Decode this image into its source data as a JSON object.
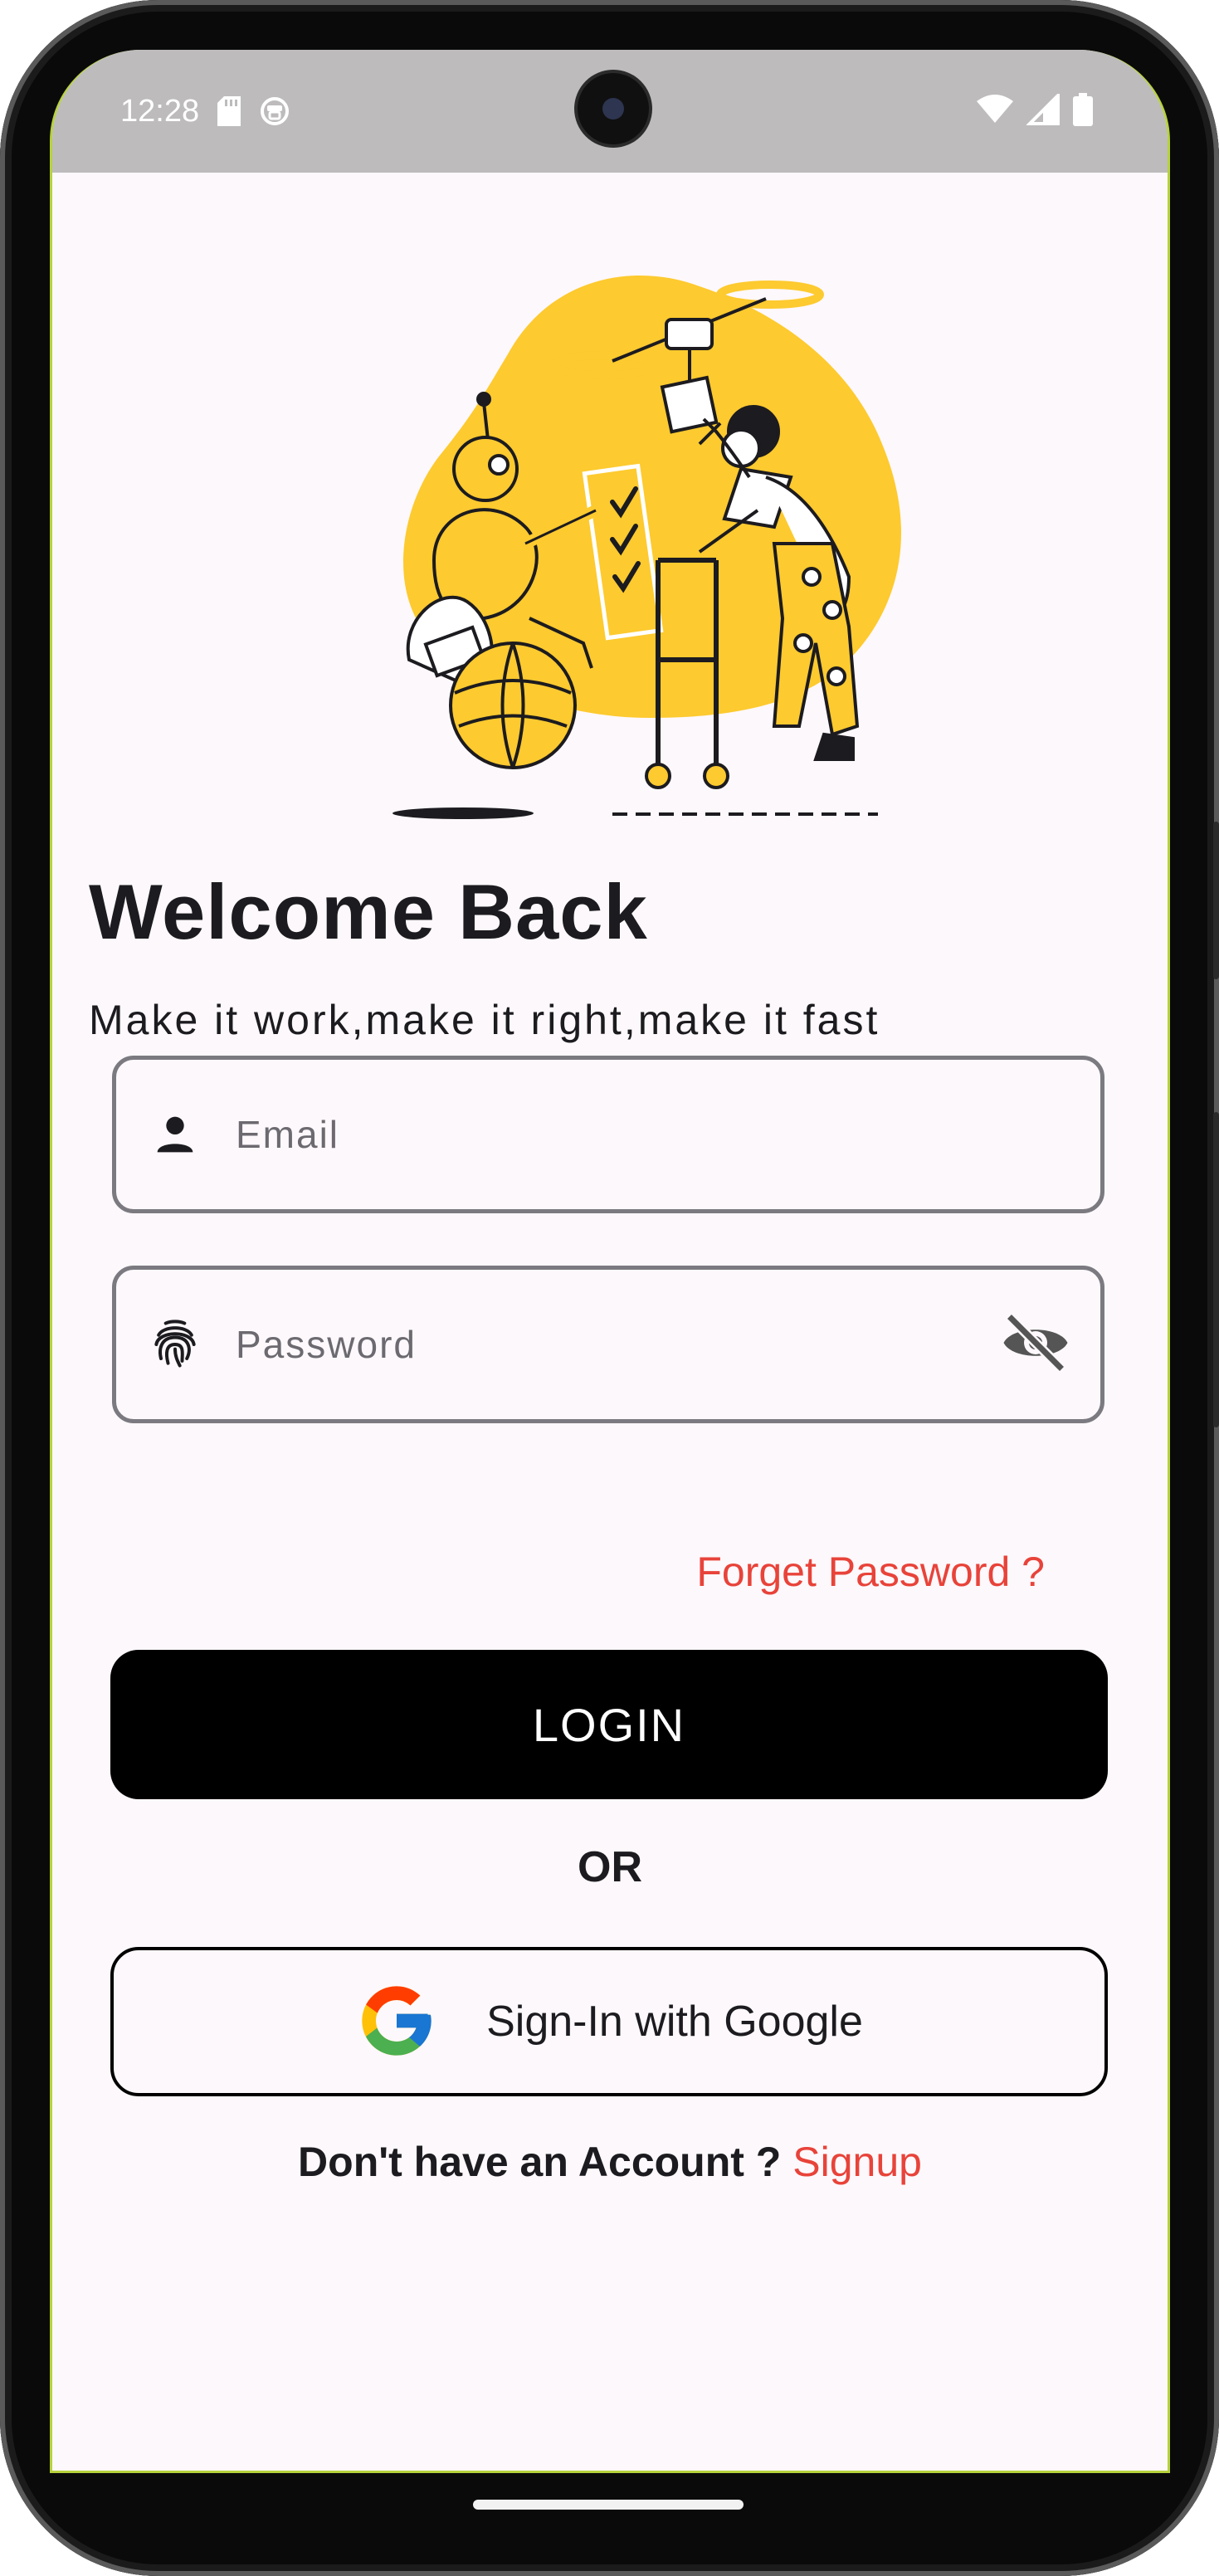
{
  "status_bar": {
    "time": "12:28",
    "left_icons": [
      "sd-card-icon",
      "app-notification-icon"
    ],
    "right_icons": [
      "wifi-icon",
      "cellular-signal-icon",
      "battery-icon"
    ]
  },
  "header": {
    "title": "Welcome Back",
    "subtitle": "Make it work,make it right,make it fast"
  },
  "form": {
    "email": {
      "placeholder": "Email",
      "value": "",
      "icon": "person-icon"
    },
    "password": {
      "placeholder": "Password",
      "value": "",
      "icon": "fingerprint-icon",
      "toggle_icon": "visibility-off-icon"
    },
    "forget_label": "Forget Password ?",
    "login_label": "LOGIN"
  },
  "divider": {
    "label": "OR"
  },
  "google": {
    "label": "Sign-In with Google",
    "icon": "google-icon"
  },
  "footer": {
    "prompt": "Don't have an Account ? ",
    "link": "Signup"
  },
  "colors": {
    "accent": "#e8433a",
    "primary_button": "#000000",
    "illustration_yellow": "#fdca2f",
    "background": "#fdf8fb",
    "status_bar": "#bdbbbc"
  }
}
